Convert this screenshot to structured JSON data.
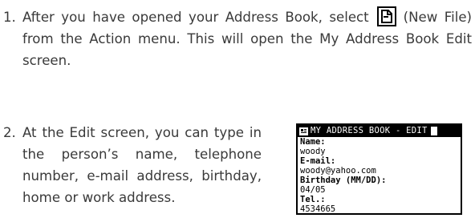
{
  "steps": [
    {
      "number": "1.",
      "text_before": "After you have opened your Address Book, select",
      "icon": "new-file-icon",
      "text_after": "(New File) from the Action menu. This will open the My Address Book Edit screen."
    },
    {
      "number": "2.",
      "text": "At the Edit screen, you can type in the person’s name, telephone number, e-mail address, birthday, home or work address."
    }
  ],
  "lcd": {
    "title": "MY ADDRESS BOOK - EDIT",
    "title_icon": "address-book-icon",
    "fields": [
      {
        "label": "Name:",
        "value": "woody"
      },
      {
        "label": "E-mail:",
        "value": "woody@yahoo.com"
      },
      {
        "label": "Birthday (MM/DD):",
        "value": "04/05"
      },
      {
        "label": "Tel.:",
        "value": "4534665"
      }
    ]
  }
}
